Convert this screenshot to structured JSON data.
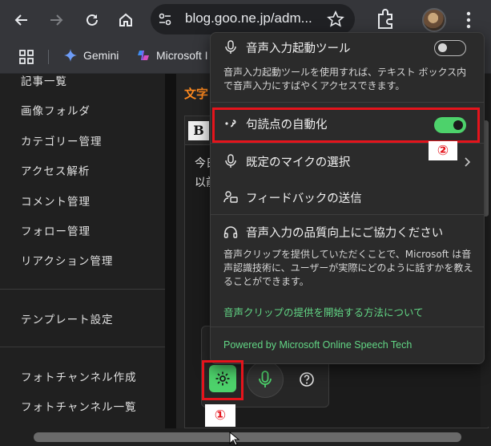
{
  "browser": {
    "url": "blog.goo.ne.jp/adm...",
    "bookmarks": [
      {
        "label": "Gemini",
        "icon": "gemini-icon"
      },
      {
        "label": "Microsoft I",
        "icon": "microsoft-copilot-icon"
      }
    ]
  },
  "sidebar": {
    "items": [
      "記事一覧",
      "画像フォルダ",
      "カテゴリー管理",
      "アクセス解析",
      "コメント管理",
      "フォロー管理",
      "リアクション管理",
      "テンプレート設定",
      "フォトチャンネル作成",
      "フォトチャンネル一覧"
    ]
  },
  "main": {
    "title_fragment": "文字",
    "bold_button": "B",
    "text_lines": [
      "今日",
      "以前"
    ]
  },
  "popup": {
    "voice_launcher": {
      "title": "音声入力起動ツール",
      "description": "音声入力起動ツールを使用すれば、テキスト ボックス内で音声入力にすばやくアクセスできます。",
      "enabled": false
    },
    "auto_punctuation": {
      "title": "句読点の自動化",
      "enabled": true
    },
    "default_mic": {
      "title": "既定のマイクの選択"
    },
    "feedback": {
      "title": "フィードバックの送信"
    },
    "quality": {
      "title": "音声入力の品質向上にご協力ください",
      "description": "音声クリップを提供していただくことで、Microsoft は音声認識技術に、ユーザーが実際にどのように話すかを教えることができます。",
      "link": "音声クリップの提供を開始する方法について"
    },
    "powered_by": "Powered by Microsoft Online Speech Tech"
  },
  "annotations": {
    "badge_1": "①",
    "badge_2": "②"
  },
  "colors": {
    "accent_green": "#4dd26b",
    "annotation_red": "#e5141c",
    "title_orange": "#ff8a1f"
  }
}
